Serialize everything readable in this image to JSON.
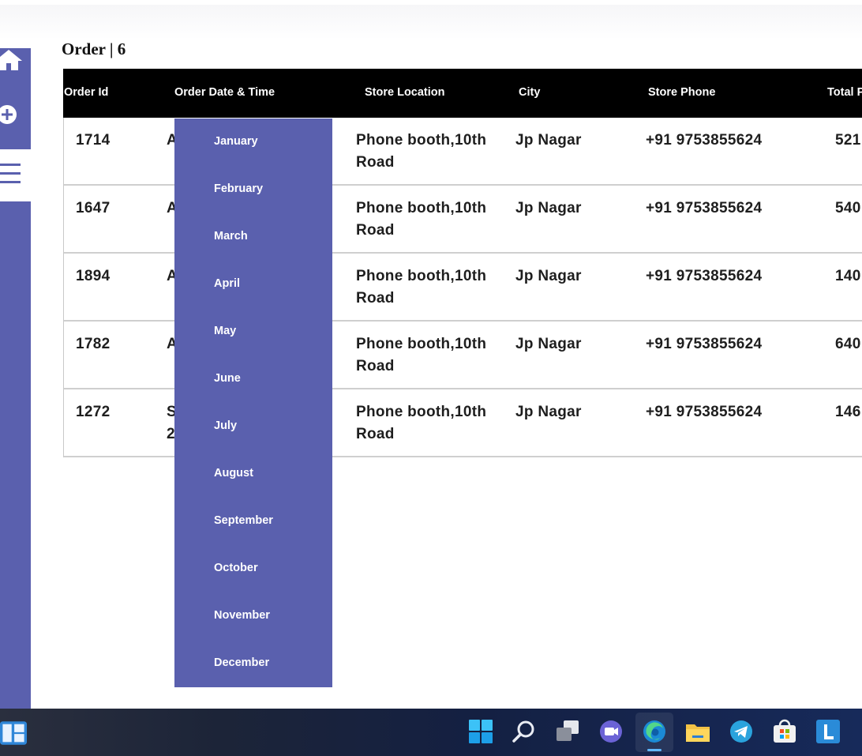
{
  "page": {
    "title": "Order | 6"
  },
  "table": {
    "columns": [
      "Order Id",
      "Order Date & Time",
      "Store Location",
      "City",
      "Store Phone",
      "Total P"
    ],
    "rows": [
      {
        "order_id": "1714",
        "date": "A",
        "location": "Phone booth,10th Road",
        "city": "Jp Nagar",
        "phone": "+91 9753855624",
        "total": "521"
      },
      {
        "order_id": "1647",
        "date": "A",
        "location": "Phone booth,10th Road",
        "city": "Jp Nagar",
        "phone": "+91 9753855624",
        "total": "540"
      },
      {
        "order_id": "1894",
        "date": "A",
        "location": "Phone booth,10th Road",
        "city": "Jp Nagar",
        "phone": "+91 9753855624",
        "total": "140"
      },
      {
        "order_id": "1782",
        "date": "A",
        "location": "Phone booth,10th Road",
        "city": "Jp Nagar",
        "phone": "+91 9753855624",
        "total": "640"
      },
      {
        "order_id": "1272",
        "date": "S",
        "date_line2": "2",
        "location": "Phone booth,10th Road",
        "city": "Jp Nagar",
        "phone": "+91 9753855624",
        "total": "146"
      }
    ]
  },
  "month_dropdown": {
    "items": [
      "January",
      "February",
      "March",
      "April",
      "May",
      "June",
      "July",
      "August",
      "September",
      "October",
      "November",
      "December"
    ]
  },
  "sidebar": {
    "icons": [
      "home-icon",
      "add-circle-icon",
      "hamburger-menu-icon"
    ]
  },
  "taskbar": {
    "icons": [
      "widgets-icon",
      "start-icon",
      "search-icon",
      "task-view-icon",
      "teams-chat-icon",
      "edge-icon",
      "file-explorer-icon",
      "telegram-icon",
      "store-icon",
      "l-app-icon",
      "extra-app-icon"
    ]
  },
  "colors": {
    "accent": "#5a60ae",
    "header_bg": "#000000",
    "row_border": "#cfcfcf"
  }
}
